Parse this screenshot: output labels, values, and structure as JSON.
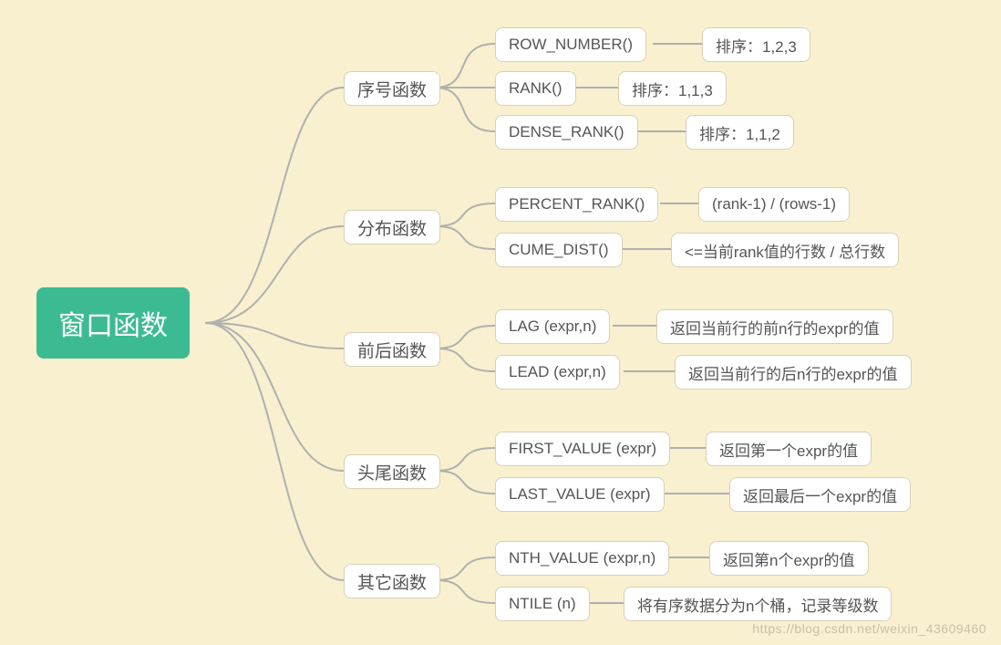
{
  "root": "窗口函数",
  "categories": [
    {
      "name": "序号函数",
      "functions": [
        {
          "fn": "ROW_NUMBER()",
          "desc": "排序：1,2,3"
        },
        {
          "fn": "RANK()",
          "desc": "排序：1,1,3"
        },
        {
          "fn": "DENSE_RANK()",
          "desc": "排序：1,1,2"
        }
      ]
    },
    {
      "name": "分布函数",
      "functions": [
        {
          "fn": "PERCENT_RANK()",
          "desc": "(rank-1) / (rows-1)"
        },
        {
          "fn": "CUME_DIST()",
          "desc": "<=当前rank值的行数 / 总行数"
        }
      ]
    },
    {
      "name": "前后函数",
      "functions": [
        {
          "fn": "LAG (expr,n)",
          "desc": "返回当前行的前n行的expr的值"
        },
        {
          "fn": "LEAD (expr,n)",
          "desc": "返回当前行的后n行的expr的值"
        }
      ]
    },
    {
      "name": "头尾函数",
      "functions": [
        {
          "fn": "FIRST_VALUE (expr)",
          "desc": "返回第一个expr的值"
        },
        {
          "fn": "LAST_VALUE (expr)",
          "desc": "返回最后一个expr的值"
        }
      ]
    },
    {
      "name": "其它函数",
      "functions": [
        {
          "fn": "NTH_VALUE (expr,n)",
          "desc": "返回第n个expr的值"
        },
        {
          "fn": "NTILE (n)",
          "desc": "将有序数据分为n个桶，记录等级数"
        }
      ]
    }
  ],
  "watermark": "https://blog.csdn.net/weixin_43609460",
  "colors": {
    "background": "#f8f0cf",
    "rootFill": "#3cbb92",
    "nodeBorder": "#d9d0b7",
    "connector": "#b0b0b0",
    "text": "#555555"
  }
}
